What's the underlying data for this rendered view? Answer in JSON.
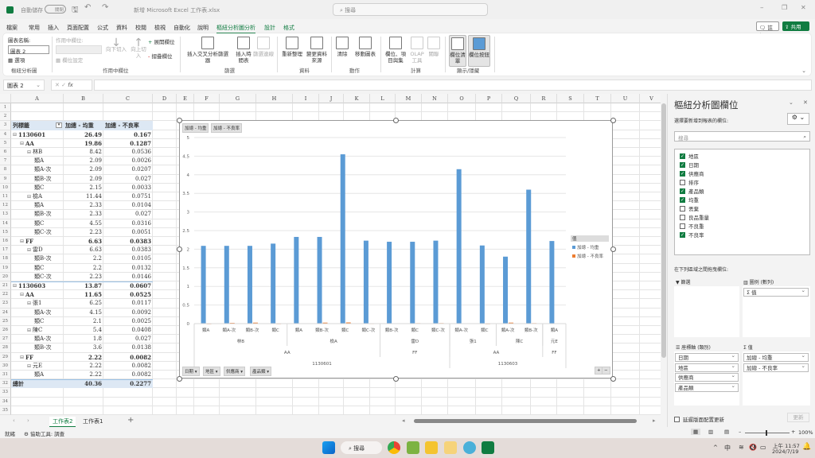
{
  "titlebar": {
    "autosave_label": "自動儲存",
    "autosave_state": "關閉",
    "filename": "新增 Microsoft Excel 工作表.xlsx",
    "search_placeholder": "搜尋"
  },
  "tabs": [
    "檔案",
    "常用",
    "插入",
    "頁面配置",
    "公式",
    "資料",
    "校閱",
    "檢視",
    "自動化",
    "說明",
    "樞紐分析圖分析",
    "設計",
    "格式"
  ],
  "active_tab": "樞紐分析圖分析",
  "header_buttons": {
    "comment": "註解",
    "share": "共用"
  },
  "ribbon": {
    "chart_name_label": "圖表名稱:",
    "chart_name_value": "圖表 2",
    "options": "選項",
    "group1": "樞紐分析圖",
    "active_field_label": "作用中欄位:",
    "field_settings": "欄位設定",
    "drill_down": "向下切入",
    "drill_up": "向上切入",
    "expand": "展開欄位",
    "collapse": "摺疊欄位",
    "group2": "作用中欄位",
    "insert_slicer": "插入交叉分析篩選器",
    "insert_timeline": "插入時間表",
    "filter_connections": "篩選連線",
    "group3": "篩選",
    "refresh": "重新整理",
    "change_source": "變更資料來源",
    "group4": "資料",
    "clear": "清除",
    "move_chart": "移動圖表",
    "group5": "動作",
    "fields_items": "欄位、項目與集",
    "olap": "OLAP 工具",
    "relationships": "關聯",
    "group6": "計算",
    "field_list": "欄位清單",
    "field_buttons": "欄位按鈕",
    "group7": "顯示/隱藏"
  },
  "formula_bar": {
    "name_box": "圖表 2",
    "value": ""
  },
  "columns": [
    "A",
    "B",
    "C",
    "D",
    "E",
    "F",
    "G",
    "H",
    "I",
    "J",
    "K",
    "L",
    "M",
    "N",
    "O",
    "P",
    "Q",
    "R",
    "S",
    "T",
    "U",
    "V"
  ],
  "pivot": {
    "headers": [
      "列標籤",
      "加總 - 均重",
      "加總 - 不良率"
    ],
    "rows": [
      {
        "label": "1130601",
        "level": 0,
        "bold": true,
        "v1": "26.49",
        "v2": "0.167"
      },
      {
        "label": "AA",
        "level": 1,
        "bold": true,
        "v1": "19.86",
        "v2": "0.1287"
      },
      {
        "label": "林B",
        "level": 2,
        "bold": false,
        "v1": "8.42",
        "v2": "0.0536"
      },
      {
        "label": "類A",
        "level": 3,
        "bold": false,
        "v1": "2.09",
        "v2": "0.0026"
      },
      {
        "label": "類A-次",
        "level": 3,
        "bold": false,
        "v1": "2.09",
        "v2": "0.0207"
      },
      {
        "label": "類B-次",
        "level": 3,
        "bold": false,
        "v1": "2.09",
        "v2": "0.027"
      },
      {
        "label": "類C",
        "level": 3,
        "bold": false,
        "v1": "2.15",
        "v2": "0.0033"
      },
      {
        "label": "檢A",
        "level": 2,
        "bold": false,
        "v1": "11.44",
        "v2": "0.0751"
      },
      {
        "label": "類A",
        "level": 3,
        "bold": false,
        "v1": "2.33",
        "v2": "0.0104"
      },
      {
        "label": "類B-次",
        "level": 3,
        "bold": false,
        "v1": "2.33",
        "v2": "0.027"
      },
      {
        "label": "類C",
        "level": 3,
        "bold": false,
        "v1": "4.55",
        "v2": "0.0316"
      },
      {
        "label": "類C-次",
        "level": 3,
        "bold": false,
        "v1": "2.23",
        "v2": "0.0051"
      },
      {
        "label": "FF",
        "level": 1,
        "bold": true,
        "v1": "6.63",
        "v2": "0.0383"
      },
      {
        "label": "雷D",
        "level": 2,
        "bold": false,
        "v1": "6.63",
        "v2": "0.0383"
      },
      {
        "label": "類B-次",
        "level": 3,
        "bold": false,
        "v1": "2.2",
        "v2": "0.0105"
      },
      {
        "label": "類C",
        "level": 3,
        "bold": false,
        "v1": "2.2",
        "v2": "0.0132"
      },
      {
        "label": "類C-次",
        "level": 3,
        "bold": false,
        "v1": "2.23",
        "v2": "0.0146"
      },
      {
        "label": "1130603",
        "level": 0,
        "bold": true,
        "v1": "13.87",
        "v2": "0.0607"
      },
      {
        "label": "AA",
        "level": 1,
        "bold": true,
        "v1": "11.65",
        "v2": "0.0525"
      },
      {
        "label": "張1",
        "level": 2,
        "bold": false,
        "v1": "6.25",
        "v2": "0.0117"
      },
      {
        "label": "類A-次",
        "level": 3,
        "bold": false,
        "v1": "4.15",
        "v2": "0.0092"
      },
      {
        "label": "類C",
        "level": 3,
        "bold": false,
        "v1": "2.1",
        "v2": "0.0025"
      },
      {
        "label": "陳C",
        "level": 2,
        "bold": false,
        "v1": "5.4",
        "v2": "0.0408"
      },
      {
        "label": "類A-次",
        "level": 3,
        "bold": false,
        "v1": "1.8",
        "v2": "0.027"
      },
      {
        "label": "類B-次",
        "level": 3,
        "bold": false,
        "v1": "3.6",
        "v2": "0.0138"
      },
      {
        "label": "FF",
        "level": 1,
        "bold": true,
        "v1": "2.22",
        "v2": "0.0082"
      },
      {
        "label": "元E",
        "level": 2,
        "bold": false,
        "v1": "2.22",
        "v2": "0.0082"
      },
      {
        "label": "類A",
        "level": 3,
        "bold": false,
        "v1": "2.22",
        "v2": "0.0082"
      }
    ],
    "total": {
      "label": "總計",
      "v1": "40.36",
      "v2": "0.2277"
    }
  },
  "chart_data": {
    "type": "bar",
    "categories": [
      "類A",
      "類A-次",
      "類B-次",
      "類C",
      "類A",
      "類B-次",
      "類C",
      "類C-次",
      "類B-次",
      "類C",
      "類C-次",
      "類A-次",
      "類C",
      "類A-次",
      "類B-次",
      "類A"
    ],
    "category_groups": [
      {
        "level": "供應商",
        "groups": [
          {
            "label": "林B",
            "span": 4
          },
          {
            "label": "檢A",
            "span": 4
          },
          {
            "label": "雷D",
            "span": 3
          },
          {
            "label": "張1",
            "span": 2
          },
          {
            "label": "陳C",
            "span": 2
          },
          {
            "label": "元E",
            "span": 1
          }
        ]
      },
      {
        "level": "地區",
        "groups": [
          {
            "label": "AA",
            "span": 8
          },
          {
            "label": "FF",
            "span": 3
          },
          {
            "label": "AA",
            "span": 4
          },
          {
            "label": "FF",
            "span": 1
          }
        ]
      },
      {
        "level": "日期",
        "groups": [
          {
            "label": "1130601",
            "span": 11
          },
          {
            "label": "1130603",
            "span": 5
          }
        ]
      }
    ],
    "series": [
      {
        "name": "加總 - 均重",
        "color": "#5b9bd5",
        "values": [
          2.09,
          2.09,
          2.09,
          2.15,
          2.33,
          2.33,
          4.55,
          2.23,
          2.2,
          2.2,
          2.23,
          4.15,
          2.1,
          1.8,
          3.6,
          2.22
        ]
      },
      {
        "name": "加總 - 不良率",
        "color": "#ed7d31",
        "values": [
          0.0026,
          0.0207,
          0.027,
          0.0033,
          0.0104,
          0.027,
          0.0316,
          0.0051,
          0.0105,
          0.0132,
          0.0146,
          0.0092,
          0.0025,
          0.027,
          0.0138,
          0.0082
        ]
      }
    ],
    "yticks": [
      "0",
      "0.5",
      "1",
      "1.5",
      "2",
      "2.5",
      "3",
      "3.5",
      "4",
      "4.5",
      "5"
    ],
    "ylim": [
      0,
      5
    ],
    "grid": true,
    "legend_title": "值",
    "legend_position": "right",
    "value_buttons": [
      "加總 - 均重",
      "加總 - 不良率"
    ],
    "axis_buttons": [
      "日期",
      "地區",
      "供應商",
      "產品類"
    ]
  },
  "sheet_tabs": [
    "工作表2",
    "工作表1"
  ],
  "active_sheet": "工作表2",
  "status": {
    "ready": "就緒",
    "accessibility": "協助工具: 調查",
    "zoom": "100%"
  },
  "pane": {
    "title": "樞紐分析圖欄位",
    "choose_label": "選擇要新增到報表的欄位:",
    "search_placeholder": "搜尋",
    "fields": [
      {
        "name": "地區",
        "checked": true
      },
      {
        "name": "日期",
        "checked": true
      },
      {
        "name": "供應商",
        "checked": true
      },
      {
        "name": "排序",
        "checked": false
      },
      {
        "name": "產品類",
        "checked": true
      },
      {
        "name": "均重",
        "checked": true
      },
      {
        "name": "丟棄",
        "checked": false
      },
      {
        "name": "良品重量",
        "checked": false
      },
      {
        "name": "不良重",
        "checked": false
      },
      {
        "name": "不良率",
        "checked": true
      }
    ],
    "drag_label": "在下列區域之間拖曳欄位:",
    "filters_label": "篩選",
    "legend_label": "圖例 (數列)",
    "axis_label": "座標軸 (類別)",
    "values_label": "值",
    "legend_items": [
      "Σ 值"
    ],
    "axis_items": [
      "日期",
      "地區",
      "供應商",
      "產品類"
    ],
    "value_items": [
      "加總 - 均重",
      "加總 - 不良率"
    ],
    "defer_label": "延遲版面配置更新",
    "update_button": "更新"
  },
  "taskbar": {
    "search": "搜尋",
    "ime": "中",
    "time": "上午 11:57",
    "date": "2024/7/19"
  }
}
